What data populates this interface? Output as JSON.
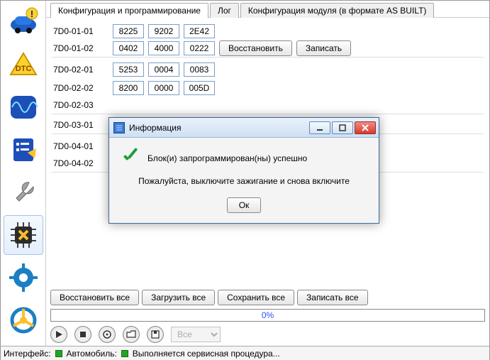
{
  "sidebar": {
    "items": [
      {
        "name": "car-info-icon"
      },
      {
        "name": "dtc-icon",
        "label": "DTC"
      },
      {
        "name": "oscilloscope-icon"
      },
      {
        "name": "checklist-icon"
      },
      {
        "name": "wrench-icon"
      },
      {
        "name": "chip-icon"
      },
      {
        "name": "gear-icon"
      },
      {
        "name": "steering-icon"
      }
    ]
  },
  "tabs": {
    "items": [
      {
        "label": "Конфигурация и программирование",
        "active": true
      },
      {
        "label": "Лог",
        "active": false
      },
      {
        "label": "Конфигурация модуля (в формате AS BUILT)",
        "active": false
      }
    ]
  },
  "rows": [
    {
      "addr": "7D0-01-01",
      "vals": [
        "8225",
        "9202",
        "2E42"
      ],
      "sep": false,
      "btns": []
    },
    {
      "addr": "7D0-01-02",
      "vals": [
        "0402",
        "4000",
        "0222"
      ],
      "sep": true,
      "btns": [
        "Восстановить",
        "Записать"
      ]
    },
    {
      "addr": "7D0-02-01",
      "vals": [
        "5253",
        "0004",
        "0083"
      ],
      "sep": false,
      "btns": []
    },
    {
      "addr": "7D0-02-02",
      "vals": [
        "8200",
        "0000",
        "005D"
      ],
      "sep": false,
      "btns": []
    },
    {
      "addr": "7D0-02-03",
      "vals": [],
      "sep": true,
      "btns": []
    },
    {
      "addr": "7D0-03-01",
      "vals": [],
      "sep": true,
      "btns": []
    },
    {
      "addr": "7D0-04-01",
      "vals": [],
      "sep": false,
      "btns": []
    },
    {
      "addr": "7D0-04-02",
      "vals": [],
      "sep": true,
      "btns": []
    }
  ],
  "bottom_actions": [
    "Восстановить все",
    "Загрузить все",
    "Сохранить все",
    "Записать все"
  ],
  "progress": {
    "label": "0%"
  },
  "dropdown": {
    "selected": "Все"
  },
  "statusbar": {
    "interface": "Интерфейс:",
    "car": "Автомобиль:",
    "msg": "Выполняется сервисная процедура..."
  },
  "modal": {
    "title": "Информация",
    "msg1": "Блок(и) запрограммирован(ны) успешно",
    "msg2": "Пожалуйста, выключите зажигание и снова включите",
    "ok": "Ок"
  }
}
